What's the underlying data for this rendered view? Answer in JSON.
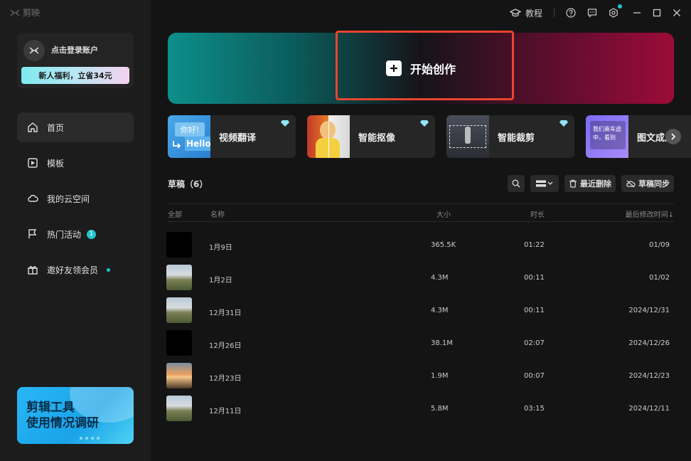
{
  "app": {
    "logo_text": "剪映"
  },
  "topbar": {
    "tutorial_label": "教程",
    "icons": [
      "help-icon",
      "feedback-icon",
      "settings-icon",
      "minimize-icon",
      "maximize-icon",
      "close-icon"
    ]
  },
  "account": {
    "login_label": "点击登录账户",
    "promo_label": "新人福利，立省34元"
  },
  "sidebar": {
    "items": [
      {
        "label": "首页",
        "icon": "home-icon"
      },
      {
        "label": "模板",
        "icon": "template-icon"
      },
      {
        "label": "我的云空间",
        "icon": "cloud-icon"
      },
      {
        "label": "热门活动",
        "icon": "flag-icon",
        "badge": "1"
      },
      {
        "label": "邀好友领会员",
        "icon": "gift-icon"
      }
    ]
  },
  "survey": {
    "line1": "剪辑工具",
    "line2": "使用情况调研"
  },
  "hero": {
    "label": "开始创作"
  },
  "features": [
    {
      "label": "视频翻译",
      "thumb_text1": "你好!",
      "thumb_text2": "Hello"
    },
    {
      "label": "智能抠像"
    },
    {
      "label": "智能裁剪"
    },
    {
      "label": "图文成片",
      "thumb_text": "我们乘车途中，看到"
    }
  ],
  "drafts": {
    "title": "草稿（6）",
    "recent_delete_label": "最近删除",
    "sync_label": "草稿同步",
    "columns": {
      "all": "全部",
      "name": "名称",
      "size": "大小",
      "duration": "时长",
      "modified": "最后修改时间↓"
    },
    "rows": [
      {
        "name": "1月9日",
        "size": "365.5K",
        "duration": "01:22",
        "modified": "01/09",
        "thumb": "black"
      },
      {
        "name": "1月2日",
        "size": "4.3M",
        "duration": "00:11",
        "modified": "01/02",
        "thumb": "landscape"
      },
      {
        "name": "12月31日",
        "size": "4.3M",
        "duration": "00:11",
        "modified": "2024/12/31",
        "thumb": "landscape"
      },
      {
        "name": "12月26日",
        "size": "38.1M",
        "duration": "02:07",
        "modified": "2024/12/26",
        "thumb": "black"
      },
      {
        "name": "12月23日",
        "size": "1.9M",
        "duration": "00:07",
        "modified": "2024/12/23",
        "thumb": "sunset"
      },
      {
        "name": "12月11日",
        "size": "5.8M",
        "duration": "03:15",
        "modified": "2024/12/11",
        "thumb": "landscape"
      }
    ]
  },
  "colors": {
    "accent": "#22c3d0",
    "highlight": "#e8452c"
  }
}
